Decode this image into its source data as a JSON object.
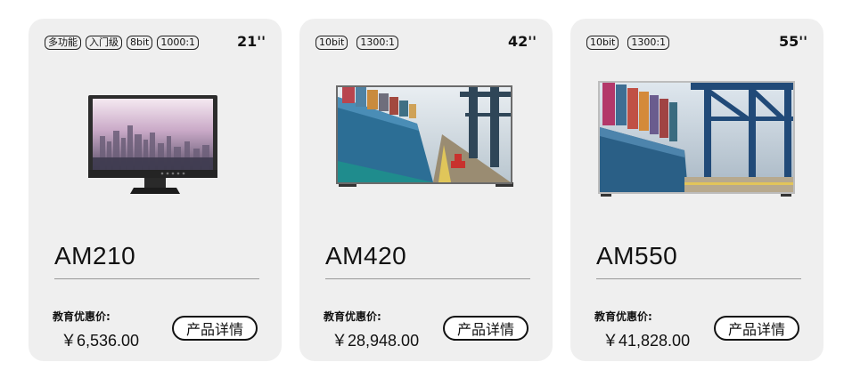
{
  "products": [
    {
      "tags": [
        "多功能",
        "入门级",
        "8bit",
        "1000:1"
      ],
      "size": "21''",
      "model": "AM210",
      "edu_label": "教育优惠价:",
      "price": "￥6,536.00",
      "detail_label": "产品详情",
      "image_icon": "monitor-city-skyline-image"
    },
    {
      "tags": [
        "10bit",
        "1300:1"
      ],
      "size": "42''",
      "model": "AM420",
      "edu_label": "教育优惠价:",
      "price": "￥28,948.00",
      "detail_label": "产品详情",
      "image_icon": "monitor-container-ship-image"
    },
    {
      "tags": [
        "10bit",
        "1300:1"
      ],
      "size": "55''",
      "model": "AM550",
      "edu_label": "教育优惠价:",
      "price": "￥41,828.00",
      "detail_label": "产品详情",
      "image_icon": "monitor-port-cranes-image"
    }
  ],
  "colors": {
    "card_bg": "#efefef",
    "text": "#111111",
    "divider": "#999999"
  }
}
